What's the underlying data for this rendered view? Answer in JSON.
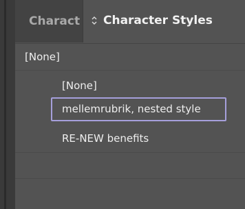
{
  "tabs": {
    "inactive_label": "Charact",
    "active_label": "Character Styles",
    "active_icon": "chevron-updown-icon"
  },
  "list": {
    "root": "[None]",
    "items": [
      "[None]",
      "mellemrubrik, nested style",
      "RE-NEW benefits"
    ]
  },
  "colors": {
    "panel_bg": "#535353",
    "tabbar_bg": "#3c3c3c",
    "selection_border": "#a6a0dc"
  }
}
